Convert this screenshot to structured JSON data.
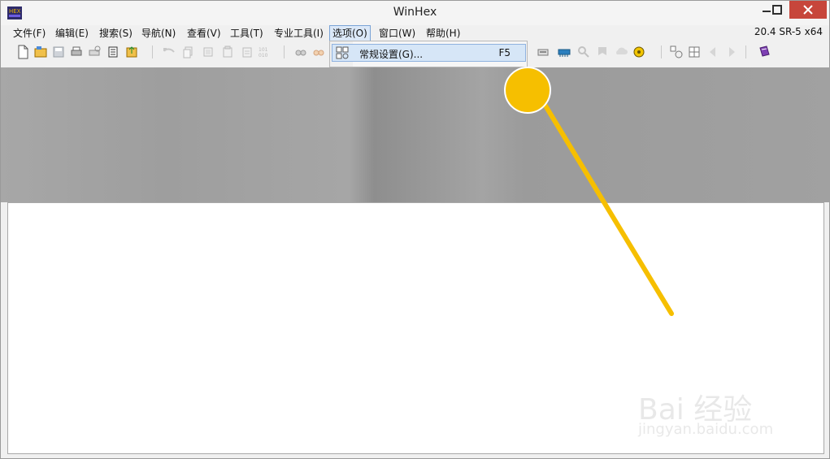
{
  "window": {
    "title": "WinHex",
    "version": "20.4 SR-5 x64"
  },
  "menu": {
    "items": [
      {
        "label": "文件(F)"
      },
      {
        "label": "编辑(E)"
      },
      {
        "label": "搜索(S)"
      },
      {
        "label": "导航(N)"
      },
      {
        "label": "查看(V)"
      },
      {
        "label": "工具(T)"
      },
      {
        "label": "专业工具(I)"
      },
      {
        "label": "选项(O)",
        "active": true
      },
      {
        "label": "窗口(W)"
      },
      {
        "label": "帮助(H)"
      }
    ]
  },
  "dropdown": {
    "item_label": "常规设置(G)...",
    "shortcut": "F5"
  },
  "watermark": {
    "brand": "Bai 经验",
    "url": "jingyan.baidu.com"
  },
  "colors": {
    "close_button": "#c7463b",
    "highlight": "#d6e6f7",
    "pointer": "#f6bf00"
  },
  "icons": {
    "app": "hex-icon",
    "new_file": "new-file-icon",
    "open": "open-folder-icon",
    "save": "save-icon",
    "print": "print-icon",
    "properties": "properties-icon",
    "export": "export-icon",
    "undo": "undo-icon",
    "copy": "copy-icon",
    "paste": "paste-icon",
    "binary": "binary-icon",
    "search": "binoculars-icon",
    "settings": "settings-icon"
  }
}
